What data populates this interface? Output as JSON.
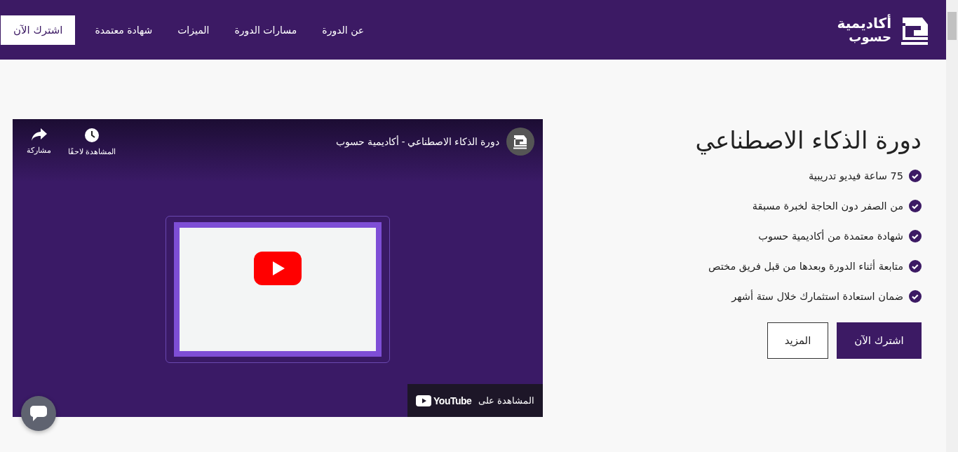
{
  "header": {
    "logo_text": [
      "أكاديمية",
      "حسوب"
    ],
    "nav": [
      {
        "label": "عن الدورة"
      },
      {
        "label": "مسارات الدورة"
      },
      {
        "label": "الميزات"
      },
      {
        "label": "شهادة معتمدة"
      }
    ],
    "cta": "اشترك الآن"
  },
  "course": {
    "title": "دورة الذكاء الاصطناعي",
    "features": [
      "75 ساعة فيديو تدريبية",
      "من الصفر دون الحاجة لخبرة مسبقة",
      "شهادة معتمدة من أكاديمية حسوب",
      "متابعة أثناء الدورة وبعدها من قبل فريق مختص",
      "ضمان استعادة استثمارك خلال ستة أشهر"
    ],
    "buttons": [
      {
        "kind": "primary",
        "label": "اشترك الآن"
      },
      {
        "kind": "outline",
        "label": "المزيد"
      }
    ]
  },
  "video": {
    "title": "دورة الذكاء الاصطناعي - أكاديمية حسوب",
    "actions": [
      {
        "kind": "clock",
        "label": "المشاهدة لاحقًا"
      },
      {
        "kind": "share",
        "label": "مشاركة"
      }
    ],
    "watch_on": "المشاهدة على",
    "brand": "YouTube"
  }
}
